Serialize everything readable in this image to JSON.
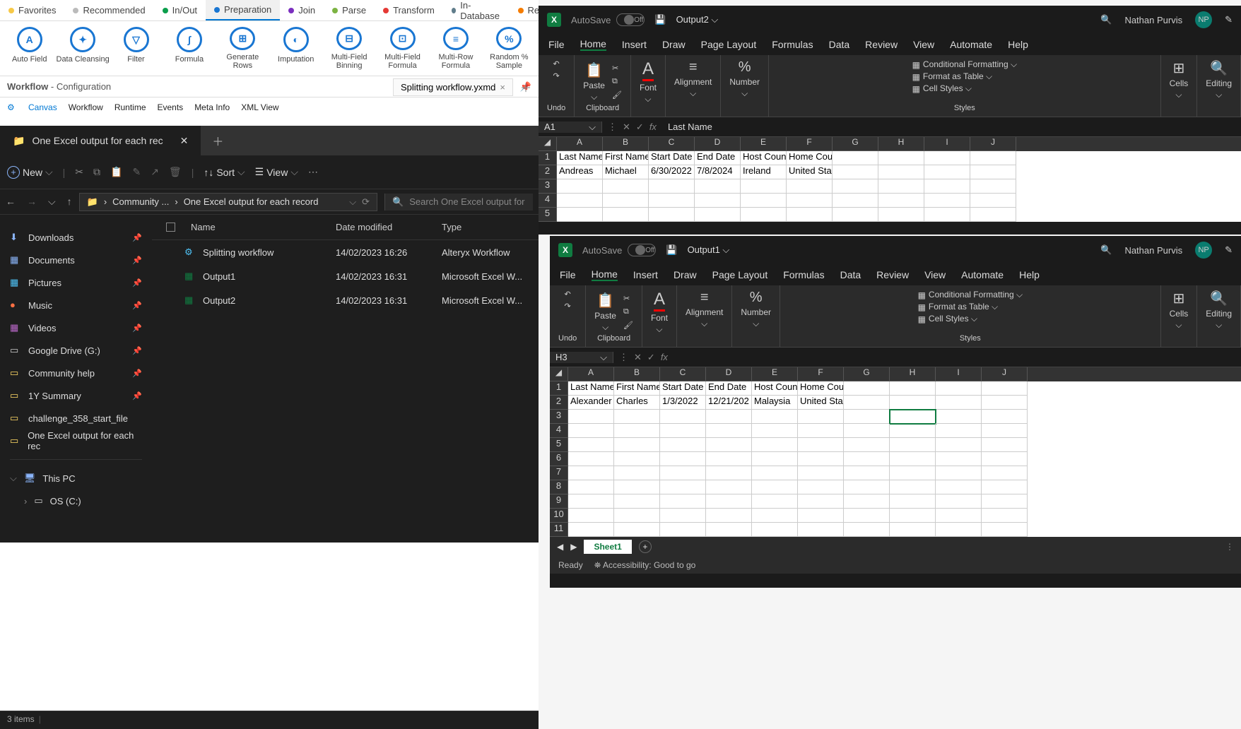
{
  "alteryx": {
    "tabs": [
      {
        "label": "Favorites",
        "color": "#f7c948"
      },
      {
        "label": "Recommended",
        "color": "#bbb"
      },
      {
        "label": "In/Out",
        "color": "#0b9e4c"
      },
      {
        "label": "Preparation",
        "color": "#1976d2",
        "active": true
      },
      {
        "label": "Join",
        "color": "#7b2fbf"
      },
      {
        "label": "Parse",
        "color": "#7cb342"
      },
      {
        "label": "Transform",
        "color": "#e53935"
      },
      {
        "label": "In-Database",
        "color": "#607d8b"
      },
      {
        "label": "Repo",
        "color": "#f57c00"
      }
    ],
    "tools": [
      "Auto Field",
      "Data Cleansing",
      "Filter",
      "Formula",
      "Generate Rows",
      "Imputation",
      "Multi-Field Binning",
      "Multi-Field Formula",
      "Multi-Row Formula",
      "Random % Sample"
    ],
    "wf_label": "Workflow",
    "wf_sub": "- Configuration",
    "wf_tab": "Splitting workflow.yxmd",
    "inner_tabs": [
      "Canvas",
      "Workflow",
      "Runtime",
      "Events",
      "Meta Info",
      "XML View"
    ]
  },
  "explorer": {
    "tab": "One Excel output for each rec",
    "new": "New",
    "sort": "Sort",
    "view": "View",
    "crumb1": "Community ...",
    "crumb2": "One Excel output for each record",
    "search": "Search One Excel output for",
    "side": [
      {
        "icon": "⬇",
        "label": "Downloads",
        "pin": true,
        "color": "#8ab4f8"
      },
      {
        "icon": "▦",
        "label": "Documents",
        "pin": true,
        "color": "#8ab4f8"
      },
      {
        "icon": "▦",
        "label": "Pictures",
        "pin": true,
        "color": "#4fc3f7"
      },
      {
        "icon": "●",
        "label": "Music",
        "pin": true,
        "color": "#ff7043"
      },
      {
        "icon": "▦",
        "label": "Videos",
        "pin": true,
        "color": "#ba68c8"
      },
      {
        "icon": "▭",
        "label": "Google Drive (G:)",
        "pin": true,
        "color": "#ccc"
      },
      {
        "icon": "▭",
        "label": "Community help",
        "pin": true,
        "color": "#ffd966"
      },
      {
        "icon": "▭",
        "label": "1Y Summary",
        "pin": true,
        "color": "#ffd966"
      },
      {
        "icon": "▭",
        "label": "challenge_358_start_file",
        "pin": false,
        "color": "#ffd966"
      },
      {
        "icon": "▭",
        "label": "One Excel output for each rec",
        "pin": false,
        "color": "#ffd966"
      }
    ],
    "thispc": "This PC",
    "osdrive": "OS (C:)",
    "cols": [
      "Name",
      "Date modified",
      "Type"
    ],
    "rows": [
      {
        "icon": "⚙",
        "name": "Splitting workflow",
        "date": "14/02/2023 16:26",
        "type": "Alteryx Workflow",
        "color": "#4fc3f7"
      },
      {
        "icon": "▦",
        "name": "Output1",
        "date": "14/02/2023 16:31",
        "type": "Microsoft Excel W...",
        "color": "#107c41"
      },
      {
        "icon": "▦",
        "name": "Output2",
        "date": "14/02/2023 16:31",
        "type": "Microsoft Excel W...",
        "color": "#107c41"
      }
    ],
    "status": "3 items"
  },
  "excel_shared": {
    "autosave": "AutoSave",
    "off": "Off",
    "menu": [
      "File",
      "Home",
      "Insert",
      "Draw",
      "Page Layout",
      "Formulas",
      "Data",
      "Review",
      "View",
      "Automate",
      "Help"
    ],
    "ribbon": {
      "undo": "Undo",
      "clipboard": "Clipboard",
      "paste": "Paste",
      "font": "Font",
      "alignment": "Alignment",
      "number": "Number",
      "cond": "Conditional Formatting",
      "table": "Format as Table",
      "cellstyles": "Cell Styles",
      "styles": "Styles",
      "cells": "Cells",
      "editing": "Editing"
    },
    "cols": [
      "A",
      "B",
      "C",
      "D",
      "E",
      "F",
      "G",
      "H",
      "I",
      "J"
    ],
    "headers": [
      "Last Name",
      "First Name",
      "Start Date",
      "End Date",
      "Host Coun",
      "Home Country"
    ],
    "user": "Nathan Purvis",
    "initials": "NP",
    "sheet": "Sheet1",
    "ready": "Ready",
    "access": "Accessibility: Good to go"
  },
  "excel1": {
    "file": "Output2",
    "cellref": "A1",
    "fx": "Last Name",
    "row": [
      "Andreas",
      "Michael",
      "6/30/2022",
      "7/8/2024",
      "Ireland",
      "United States"
    ]
  },
  "excel2": {
    "file": "Output1",
    "cellref": "H3",
    "fx": "",
    "row": [
      "Alexander",
      "Charles",
      "1/3/2022",
      "12/21/202",
      "Malaysia",
      "United States"
    ]
  },
  "chart_data": null
}
